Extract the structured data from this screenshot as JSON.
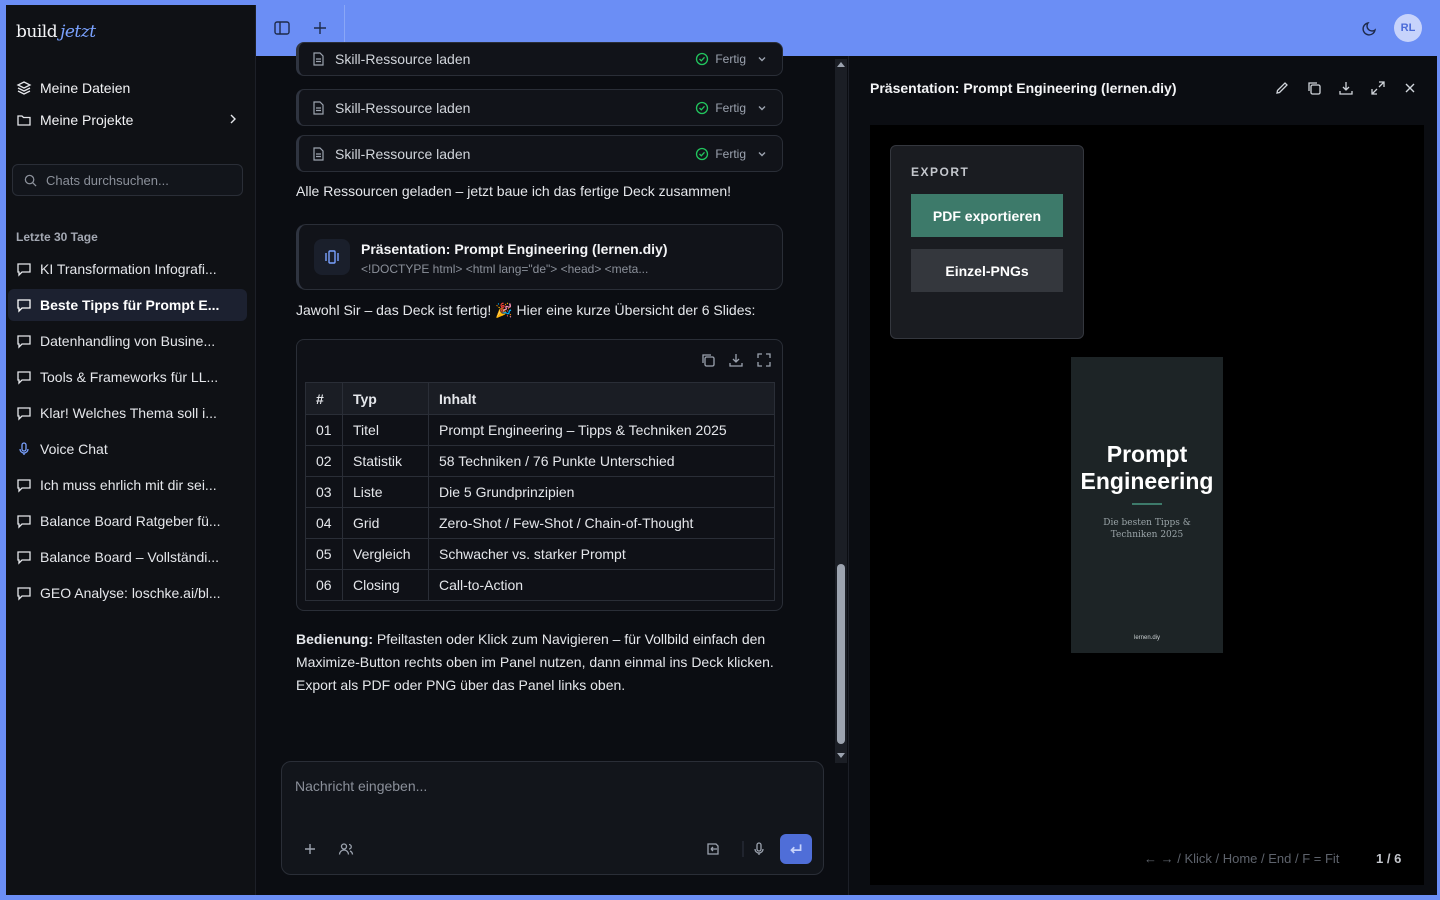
{
  "app": {
    "logo_main": "build",
    "logo_accent": "jetzt",
    "avatar": "RL"
  },
  "sidebar": {
    "nav": [
      {
        "label": "Meine Dateien",
        "icon": "layers-icon"
      },
      {
        "label": "Meine Projekte",
        "icon": "folder-icon"
      }
    ],
    "search_placeholder": "Chats durchsuchen...",
    "section": "Letzte 30 Tage",
    "chats": [
      {
        "label": "KI Transformation Infografi...",
        "icon": "chat-icon"
      },
      {
        "label": "Beste Tipps für Prompt E...",
        "icon": "chat-icon",
        "active": true
      },
      {
        "label": "Datenhandling von Busine...",
        "icon": "chat-icon"
      },
      {
        "label": "Tools & Frameworks für LL...",
        "icon": "chat-icon"
      },
      {
        "label": "Klar! Welches Thema soll i...",
        "icon": "chat-icon"
      },
      {
        "label": "Voice Chat",
        "icon": "mic-icon"
      },
      {
        "label": "Ich muss ehrlich mit dir sei...",
        "icon": "chat-icon"
      },
      {
        "label": "Balance Board Ratgeber fü...",
        "icon": "chat-icon"
      },
      {
        "label": "Balance Board – Vollständi...",
        "icon": "chat-icon"
      },
      {
        "label": "GEO Analyse: loschke.ai/bl...",
        "icon": "chat-icon"
      }
    ]
  },
  "chat": {
    "tools": [
      {
        "label": "Skill-Ressource laden",
        "status": "Fertig"
      },
      {
        "label": "Skill-Ressource laden",
        "status": "Fertig"
      },
      {
        "label": "Skill-Ressource laden",
        "status": "Fertig"
      }
    ],
    "msg1": "Alle Ressourcen geladen – jetzt baue ich das fertige Deck zusammen!",
    "artifact": {
      "title": "Präsentation: Prompt Engineering (lernen.diy)",
      "snippet": "<!DOCTYPE html> <html lang=\"de\"> <head> <meta..."
    },
    "msg2": "Jawohl Sir – das Deck ist fertig! 🎉 Hier eine kurze Übersicht der 6 Slides:",
    "table": {
      "headers": [
        "#",
        "Typ",
        "Inhalt"
      ],
      "rows": [
        [
          "01",
          "Titel",
          "Prompt Engineering – Tipps & Techniken 2025"
        ],
        [
          "02",
          "Statistik",
          "58 Techniken / 76 Punkte Unterschied"
        ],
        [
          "03",
          "Liste",
          "Die 5 Grundprinzipien"
        ],
        [
          "04",
          "Grid",
          "Zero-Shot / Few-Shot / Chain-of-Thought"
        ],
        [
          "05",
          "Vergleich",
          "Schwacher vs. starker Prompt"
        ],
        [
          "06",
          "Closing",
          "Call-to-Action"
        ]
      ]
    },
    "msg3_bold": "Bedienung:",
    "msg3": " Pfeiltasten oder Klick zum Navigieren – für Vollbild einfach den Maximize-Button rechts oben im Panel nutzen, dann einmal ins Deck klicken. Export als PDF oder PNG über das Panel links oben.",
    "composer_placeholder": "Nachricht eingeben..."
  },
  "panel": {
    "title": "Präsentation: Prompt Engineering (lernen.diy)",
    "export_label": "EXPORT",
    "btn_pdf": "PDF exportieren",
    "btn_png": "Einzel-PNGs",
    "slide_title_1": "Prompt",
    "slide_title_2": "Engineering",
    "slide_sub_1": "Die besten Tipps &",
    "slide_sub_2": "Techniken 2025",
    "slide_brand": "lernen.diy",
    "help": "← → / Klick / Home / End / F = Fit",
    "count": "1 / 6"
  },
  "colors": {
    "accent_bar": "#6b8ef5",
    "export_primary": "#3d7a6a",
    "export_secondary": "#34373d"
  }
}
